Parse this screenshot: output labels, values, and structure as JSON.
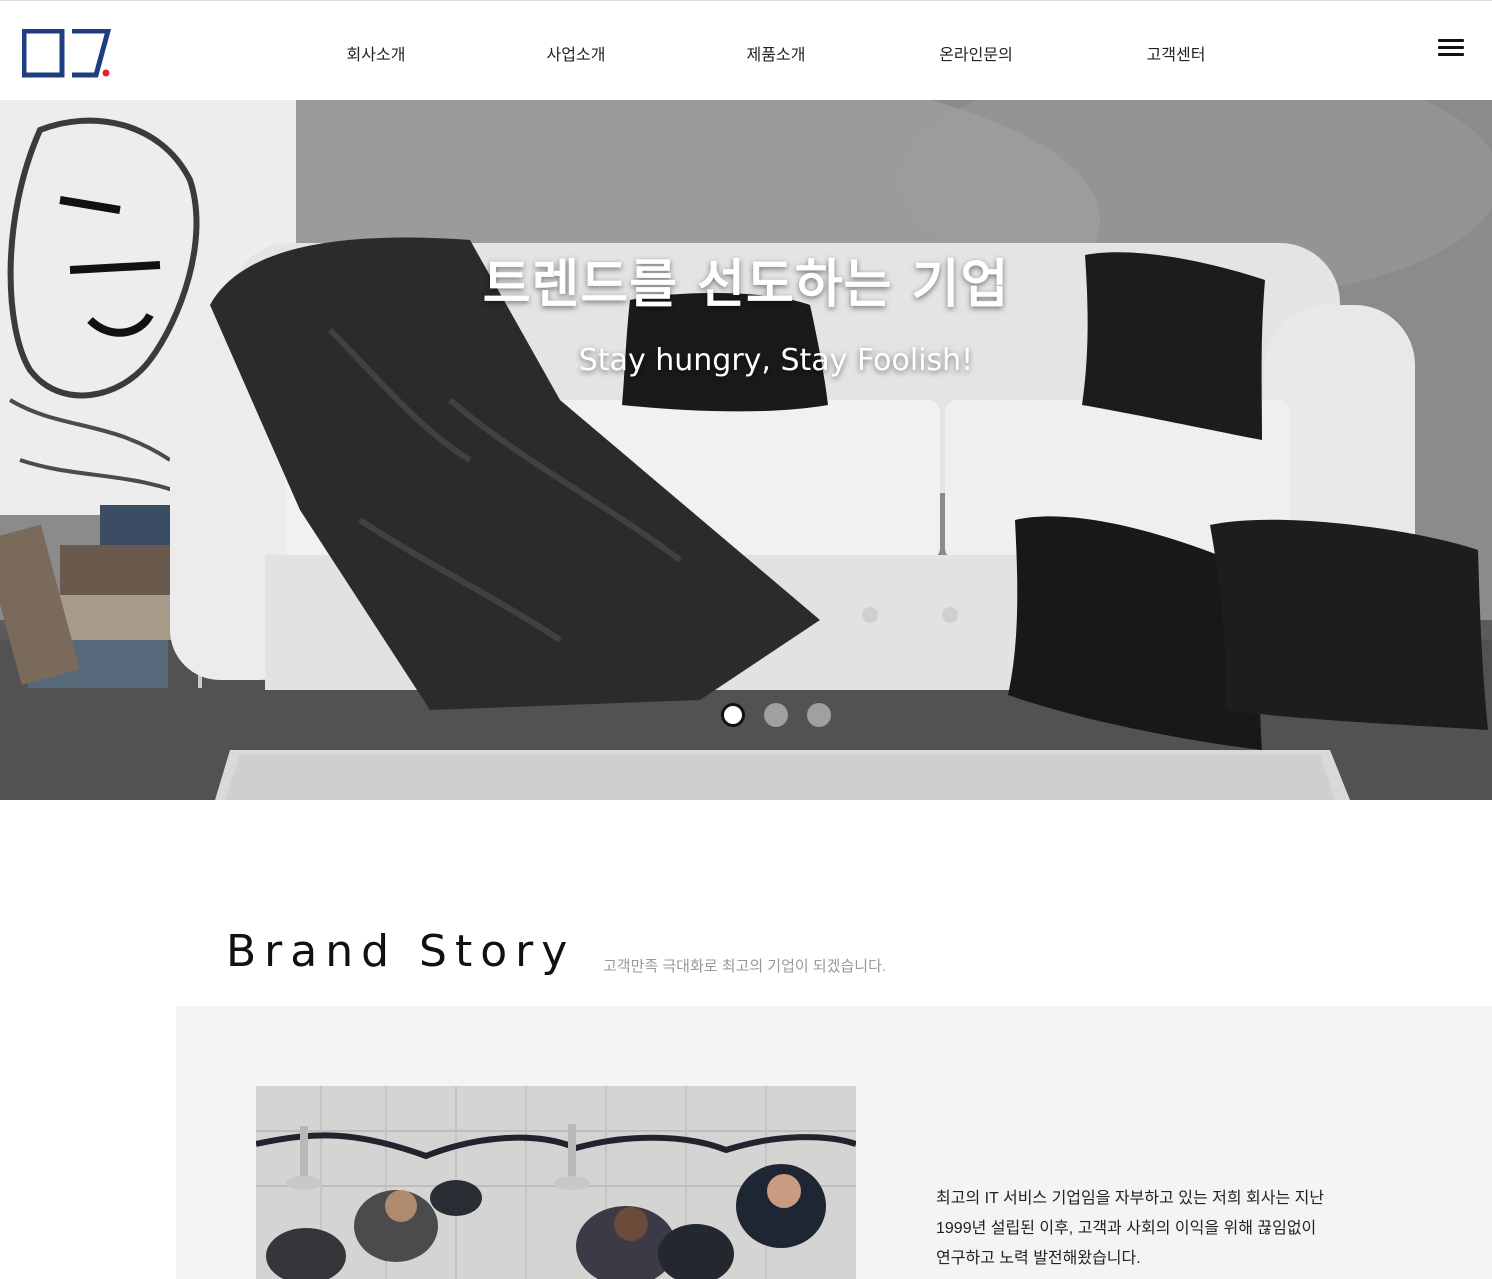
{
  "nav": {
    "items": [
      "회사소개",
      "사업소개",
      "제품소개",
      "온라인문의",
      "고객센터"
    ]
  },
  "hero": {
    "title": "트렌드를 선도하는 기업",
    "subtitle": "Stay hungry, Stay Foolish!",
    "slide_count": 3,
    "active_slide": 1
  },
  "brand": {
    "title": "Brand Story",
    "subtitle": "고객만족 극대화로 최고의 기업이 되겠습니다.",
    "body_lines": [
      "최고의 IT 서비스 기업임을 자부하고 있는 저희 회사는 지난",
      "1999년 설립된 이후, 고객과 사회의 이익을 위해 끊임없이",
      "연구하고 노력 발전해왔습니다."
    ]
  },
  "colors": {
    "logo_blue": "#1e3e82",
    "logo_red": "#e0242a",
    "brand_box_bg": "#f4f4f4"
  }
}
